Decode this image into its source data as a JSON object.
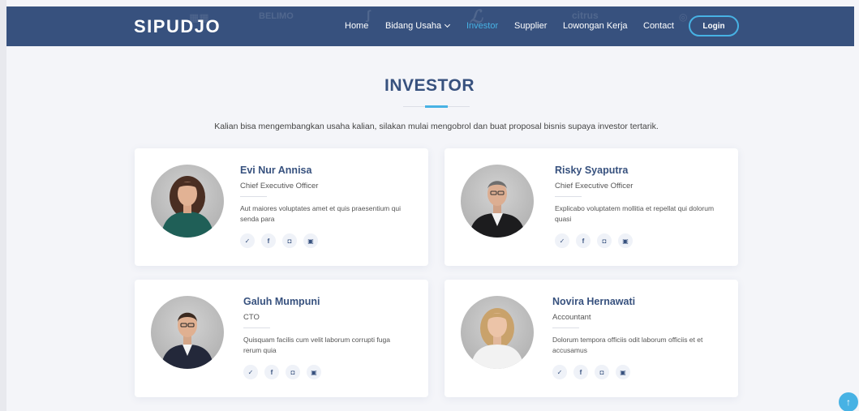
{
  "header": {
    "brand": "SIPUDJO",
    "nav": [
      {
        "label": "Home",
        "active": false
      },
      {
        "label": "Bidang Usaha",
        "active": false,
        "has_dropdown": true
      },
      {
        "label": "Investor",
        "active": true
      },
      {
        "label": "Supplier",
        "active": false
      },
      {
        "label": "Lowongan Kerja",
        "active": false
      },
      {
        "label": "Contact",
        "active": false
      }
    ],
    "login_label": "Login",
    "background_logos": [
      "BELIMO",
      "citrus"
    ]
  },
  "section": {
    "title": "INVESTOR",
    "description": "Kalian bisa mengembangkan usaha kalian, silakan mulai mengobrol dan buat proposal bisnis supaya investor tertarik."
  },
  "members": [
    {
      "name": "Evi Nur Annisa",
      "role": "Chief Executive Officer",
      "bio": "Aut maiores voluptates amet et quis praesentium qui senda para"
    },
    {
      "name": "Risky Syaputra",
      "role": "Chief Executive Officer",
      "bio": "Explicabo voluptatem mollitia et repellat qui dolorum quasi"
    },
    {
      "name": "Galuh Mumpuni",
      "role": "CTO",
      "bio": "Quisquam facilis cum velit laborum corrupti fuga rerum quia"
    },
    {
      "name": "Novira Hernawati",
      "role": "Accountant",
      "bio": "Dolorum tempora officiis odit laborum officiis et et accusamus"
    }
  ],
  "social_icons": [
    "twitter-icon",
    "facebook-icon",
    "instagram-icon",
    "linkedin-icon"
  ],
  "colors": {
    "navbar": "#37517e",
    "accent": "#47b2e4",
    "title": "#37517e",
    "page_bg": "#f4f5f9"
  }
}
